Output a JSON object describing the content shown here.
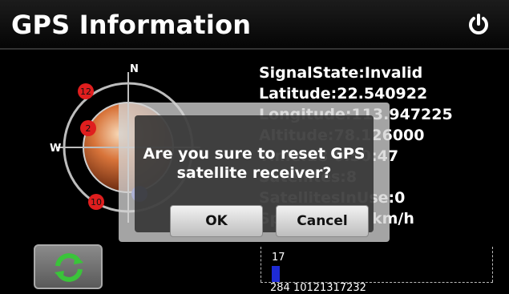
{
  "header": {
    "title": "GPS Information",
    "power_icon": "power-icon"
  },
  "radar": {
    "north": "N",
    "west": "W",
    "satellites": [
      "12",
      "2",
      "10"
    ]
  },
  "info": {
    "signal_state": "SignalState:Invalid",
    "latitude": "Latitude:22.540922",
    "longitude": "Longitude:113.947225",
    "altitude": "Altitude:78.126000",
    "time": "Time:18 0:50:47",
    "satellites": "Satellites:8",
    "satellites_in_use": "SatellitesInUse:0",
    "speed": "Speed:0.000 km/h"
  },
  "signal_chart": {
    "bar_value": "17",
    "satellite_ids": "284 10121317232"
  },
  "dialog": {
    "message_line1": "Are you sure to reset GPS",
    "message_line2": "satellite receiver?",
    "ok_label": "OK",
    "cancel_label": "Cancel"
  },
  "colors": {
    "accent_red": "#e01e1e",
    "bar_blue": "#1e2bd6",
    "refresh_green": "#3ac43a"
  }
}
